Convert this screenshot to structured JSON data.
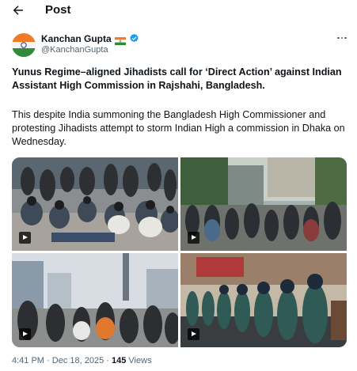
{
  "header": {
    "title": "Post",
    "back_icon": "arrow-left-icon"
  },
  "author": {
    "display_name": "Kanchan Gupta",
    "handle": "@KanchanGupta",
    "verified": true,
    "flag_icon": "india-flag-icon",
    "avatar_icon": "avatar-tricolor-icon"
  },
  "post": {
    "headline": "Yunus Regime–aligned Jihadists call for ‘Direct Action’ against Indian Assistant High Commission in Rajshahi, Bangladesh.",
    "body": "This despite India summoning the Bangladesh High Commissioner and protesting Jihadists attempt to storm Indian High a commission in Dhaka on Wednesday."
  },
  "media": [
    {
      "type": "video",
      "icon": "play-icon"
    },
    {
      "type": "video",
      "icon": "play-icon"
    },
    {
      "type": "video",
      "icon": "play-icon"
    },
    {
      "type": "video",
      "icon": "play-icon"
    }
  ],
  "meta": {
    "time": "4:41 PM",
    "separator": "·",
    "date": "Dec 18, 2025",
    "views_count": "145",
    "views_label": "Views"
  },
  "colors": {
    "text": "#0f1419",
    "secondary": "#536471",
    "verified": "#1d9bf0"
  }
}
